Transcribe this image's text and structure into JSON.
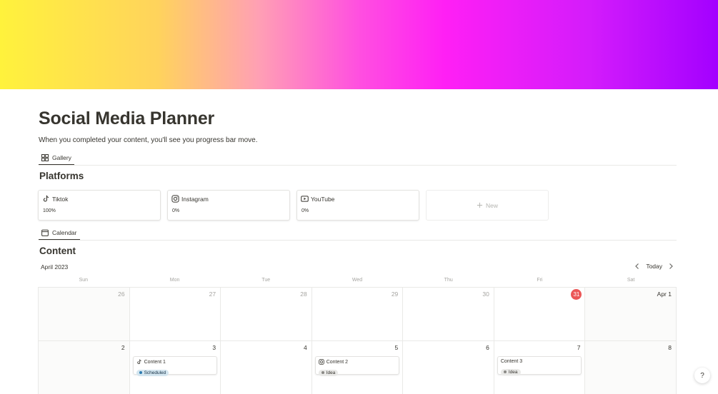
{
  "page": {
    "title": "Social Media Planner",
    "description": "When you completed your content, you'll see you progress bar move."
  },
  "views": {
    "gallery_tab": "Gallery",
    "calendar_tab": "Calendar"
  },
  "platforms": {
    "heading": "Platforms",
    "cards": [
      {
        "name": "Tiktok",
        "progress": "100%",
        "icon": "tiktok-icon"
      },
      {
        "name": "Instagram",
        "progress": "0%",
        "icon": "instagram-icon"
      },
      {
        "name": "YouTube",
        "progress": "0%",
        "icon": "youtube-icon"
      }
    ],
    "new_label": "New"
  },
  "content": {
    "heading": "Content",
    "month": "April 2023",
    "today_label": "Today",
    "weekdays": [
      "Sun",
      "Mon",
      "Tue",
      "Wed",
      "Thu",
      "Fri",
      "Sat"
    ],
    "weeks": [
      [
        "26",
        "27",
        "28",
        "29",
        "30",
        "31",
        "Apr 1"
      ],
      [
        "2",
        "3",
        "4",
        "5",
        "6",
        "7",
        "8"
      ]
    ],
    "events": [
      {
        "title": "Content 1",
        "status": "Scheduled",
        "icon": "tiktok-icon"
      },
      {
        "title": "Content 2",
        "status": "Idea",
        "icon": "instagram-icon"
      },
      {
        "title": "Content 3",
        "status": "Idea"
      }
    ]
  },
  "help": {
    "label": "?"
  },
  "colors": {
    "today_badge": "#eb5757",
    "tag_scheduled": "#d3e5ef",
    "tag_idea": "#e9e9e7"
  }
}
